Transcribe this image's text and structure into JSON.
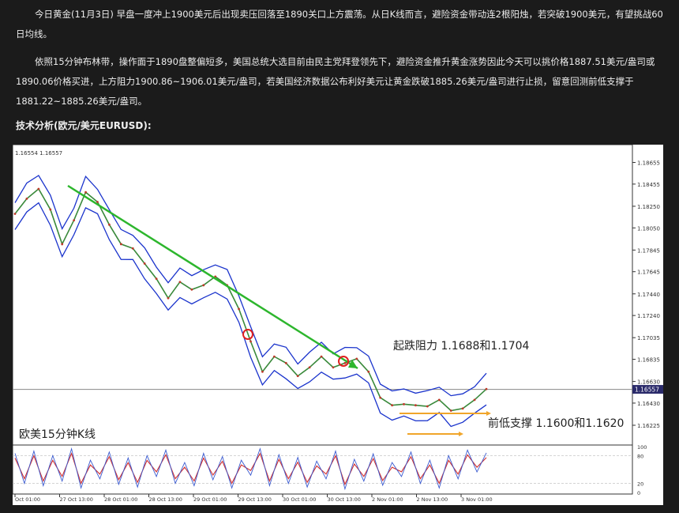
{
  "article": {
    "paragraph1": "今日黄金(11月3日) 早盘一度冲上1900美元后出现卖压回落至1890关口上方震荡。从日K线而言，避险资金带动连2根阳烛，若突破1900美元，有望挑战60日均线。",
    "paragraph2": "依照15分钟布林带，操作面于1890盘整偏短多，美国总统大选目前由民主党拜登领先下，避险资金推升黄金涨势因此今天可以挑价格1887.51美元/盎司或1890.06价格买进，上方阻力1900.86~1906.01美元/盎司，若美国经济数据公布利好美元让黄金跌破1885.26美元/盎司进行止损，留意回测前低支撑于1881.22~1885.26美元/盎司。",
    "heading": "技术分析(欧元/美元EURUSD):"
  },
  "chart_data": {
    "type": "line",
    "ohlc_header": "1.16554 1.16557",
    "current_price_label": "1.16557",
    "current_price": 1.16557,
    "y_ticks": [
      "1.18655",
      "1.18455",
      "1.18250",
      "1.18050",
      "1.17845",
      "1.17645",
      "1.17440",
      "1.17240",
      "1.17035",
      "1.16835",
      "1.16630",
      "1.16430",
      "1.16225"
    ],
    "ylim": [
      1.1613,
      1.1871
    ],
    "x_ticks": [
      "Oct 01:00",
      "27 Oct 13:00",
      "28 Oct 01:00",
      "28 Oct 13:00",
      "29 Oct 01:00",
      "29 Oct 13:00",
      "30 Oct 01:00",
      "30 Oct 13:00",
      "2 Nov 01:00",
      "2 Nov 13:00",
      "3 Nov 01:00"
    ],
    "osc_ticks": [
      "100",
      "80",
      "20",
      "0"
    ],
    "annotations": {
      "chart_title": "欧美15分钟K线",
      "resistance": "起跌阻力 1.1688和1.1704",
      "support": "前低支撑 1.1600和1.1620"
    },
    "colors": {
      "trendline": "#2db62d",
      "band": "#1a33cc",
      "support_line": "#f0a52a",
      "circle": "#e02020",
      "price_line": "#2a2a6a"
    },
    "series": [
      {
        "x": [
          0,
          5,
          10,
          15,
          20,
          25,
          30,
          35,
          40,
          45,
          50,
          55,
          60,
          65,
          70,
          75,
          80,
          85,
          90,
          95,
          100,
          105,
          110,
          115,
          120,
          125,
          130,
          135,
          140,
          145,
          150,
          155,
          160,
          165,
          170,
          175,
          180,
          185,
          190,
          195,
          200
        ],
        "values": [
          1.1818,
          1.1832,
          1.1841,
          1.1822,
          1.179,
          1.1812,
          1.1838,
          1.1829,
          1.1808,
          1.179,
          1.1786,
          1.1772,
          1.1758,
          1.174,
          1.1755,
          1.1748,
          1.1752,
          1.176,
          1.1752,
          1.173,
          1.17,
          1.1672,
          1.1686,
          1.168,
          1.1668,
          1.1676,
          1.1686,
          1.1676,
          1.168,
          1.1684,
          1.1672,
          1.1648,
          1.1641,
          1.1642,
          1.1641,
          1.164,
          1.1646,
          1.1636,
          1.1638,
          1.1646,
          1.1656
        ]
      }
    ],
    "oscillator": {
      "x": [
        0,
        4,
        8,
        12,
        16,
        20,
        24,
        28,
        32,
        36,
        40,
        44,
        48,
        52,
        56,
        60,
        64,
        68,
        72,
        76,
        80,
        84,
        88,
        92,
        96,
        100,
        104,
        108,
        112,
        116,
        120,
        124,
        128,
        132,
        136,
        140,
        144,
        148,
        152,
        156,
        160,
        164,
        168,
        172,
        176,
        180,
        184,
        188,
        192,
        196,
        200
      ],
      "values": [
        75,
        30,
        80,
        25,
        70,
        35,
        85,
        20,
        60,
        40,
        78,
        28,
        65,
        22,
        70,
        45,
        82,
        30,
        55,
        25,
        75,
        38,
        68,
        20,
        60,
        48,
        85,
        25,
        72,
        30,
        66,
        22,
        58,
        40,
        80,
        18,
        62,
        35,
        74,
        26,
        55,
        45,
        78,
        30,
        60,
        20,
        70,
        40,
        82,
        55,
        76
      ]
    }
  }
}
